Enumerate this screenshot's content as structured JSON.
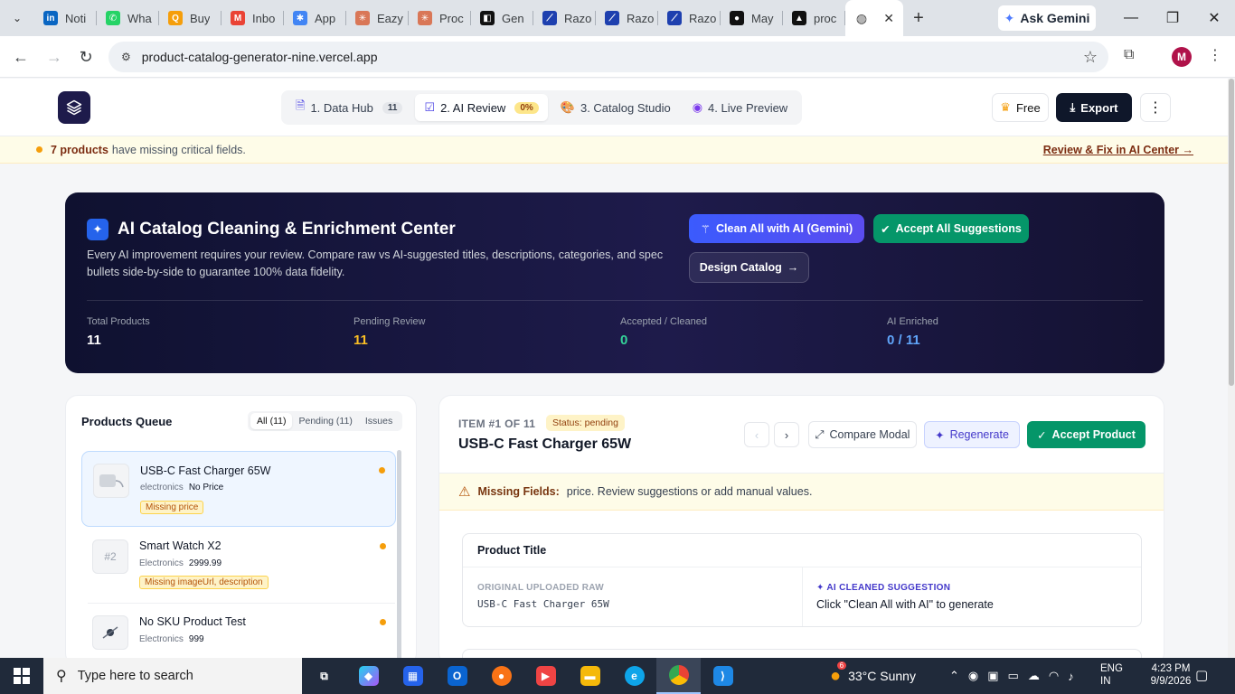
{
  "browser": {
    "tabs": [
      {
        "title": "Noti",
        "icon": "linkedin-icon",
        "color": "#0a66c2",
        "glyph": "in"
      },
      {
        "title": "Wha",
        "icon": "whatsapp-icon",
        "color": "#25d366",
        "glyph": "✆"
      },
      {
        "title": "Buy",
        "icon": "q-icon",
        "color": "#f59e0b",
        "glyph": "Q"
      },
      {
        "title": "Inbo",
        "icon": "gmail-icon",
        "color": "#ea4335",
        "glyph": "M"
      },
      {
        "title": "App",
        "icon": "apps-icon",
        "color": "#4285f4",
        "glyph": "✱"
      },
      {
        "title": "Eazy",
        "icon": "claude-icon",
        "color": "#d97757",
        "glyph": "✳"
      },
      {
        "title": "Proc",
        "icon": "claude-icon",
        "color": "#d97757",
        "glyph": "✳"
      },
      {
        "title": "Gen",
        "icon": "ai-studio-icon",
        "color": "#111111",
        "glyph": "◧"
      },
      {
        "title": "Razo",
        "icon": "razorpay-icon",
        "color": "#1e40af",
        "glyph": "⟋"
      },
      {
        "title": "Razo",
        "icon": "razorpay-icon",
        "color": "#1e40af",
        "glyph": "⟋"
      },
      {
        "title": "Razo",
        "icon": "razorpay-icon",
        "color": "#1e40af",
        "glyph": "⟋"
      },
      {
        "title": "May",
        "icon": "github-icon",
        "color": "#111111",
        "glyph": "●"
      },
      {
        "title": "proc",
        "icon": "vercel-icon",
        "color": "#111111",
        "glyph": "▲"
      }
    ],
    "active_tab_icon": "globe-icon",
    "gemini_label": "Ask Gemini",
    "url": "product-catalog-generator-nine.vercel.app"
  },
  "app": {
    "steps": [
      {
        "label": "1. Data Hub",
        "icon": "document-icon",
        "badge": "11"
      },
      {
        "label": "2. AI Review",
        "icon": "check-square-icon",
        "badge": "0%"
      },
      {
        "label": "3. Catalog Studio",
        "icon": "palette-icon",
        "badge": ""
      },
      {
        "label": "4. Live Preview",
        "icon": "eye-icon",
        "badge": ""
      }
    ],
    "free_label": "Free",
    "export_label": "Export"
  },
  "warning": {
    "count_text": "7 products",
    "rest_text": "have missing critical fields.",
    "link": "Review & Fix in AI Center →"
  },
  "hero": {
    "title": "AI Catalog Cleaning & Enrichment Center",
    "description": "Every AI improvement requires your review. Compare raw vs AI-suggested titles, descriptions, categories, and spec bullets side-by-side to guarantee 100% data fidelity.",
    "clean_all_label": "Clean All with AI (Gemini)",
    "accept_all_label": "Accept All Suggestions",
    "design_label": "Design Catalog",
    "stats": [
      {
        "label": "Total Products",
        "value": "11",
        "color": "#ffffff"
      },
      {
        "label": "Pending Review",
        "value": "11",
        "color": "#fbbf24"
      },
      {
        "label": "Accepted / Cleaned",
        "value": "0",
        "color": "#34d399"
      },
      {
        "label": "AI Enriched",
        "value": "0 / 11",
        "color": "#60a5fa"
      }
    ]
  },
  "queue": {
    "title": "Products Queue",
    "filters": [
      "All (11)",
      "Pending (11)",
      "Issues"
    ],
    "items": [
      {
        "name": "USB-C Fast Charger 65W",
        "category": "electronics",
        "price": "No Price",
        "tag": "Missing price",
        "thumb": ""
      },
      {
        "name": "Smart Watch X2",
        "category": "Electronics",
        "price": "2999.99",
        "tag": "Missing imageUrl, description",
        "thumb": "#2"
      },
      {
        "name": "No SKU Product Test",
        "category": "Electronics",
        "price": "999",
        "tag": "",
        "thumb": ""
      }
    ]
  },
  "detail": {
    "item_no": "ITEM #1 OF 11",
    "status": "Status: pending",
    "title": "USB-C Fast Charger 65W",
    "compare_label": "Compare Modal",
    "regenerate_label": "Regenerate",
    "accept_label": "Accept Product",
    "missing_label": "Missing Fields:",
    "missing_text": "price. Review suggestions or add manual values.",
    "field": {
      "name": "Product Title",
      "raw_label": "ORIGINAL UPLOADED RAW",
      "raw_value": "USB-C Fast Charger 65W",
      "ai_label": "AI CLEANED SUGGESTION",
      "ai_value": "Click \"Clean All with AI\" to generate"
    }
  },
  "taskbar": {
    "search_placeholder": "Type here to search",
    "weather": "33°C  Sunny",
    "lang1": "ENG",
    "lang2": "IN",
    "time": "4:23 PM",
    "date": "9/9/2026",
    "weather_badge": "6"
  }
}
